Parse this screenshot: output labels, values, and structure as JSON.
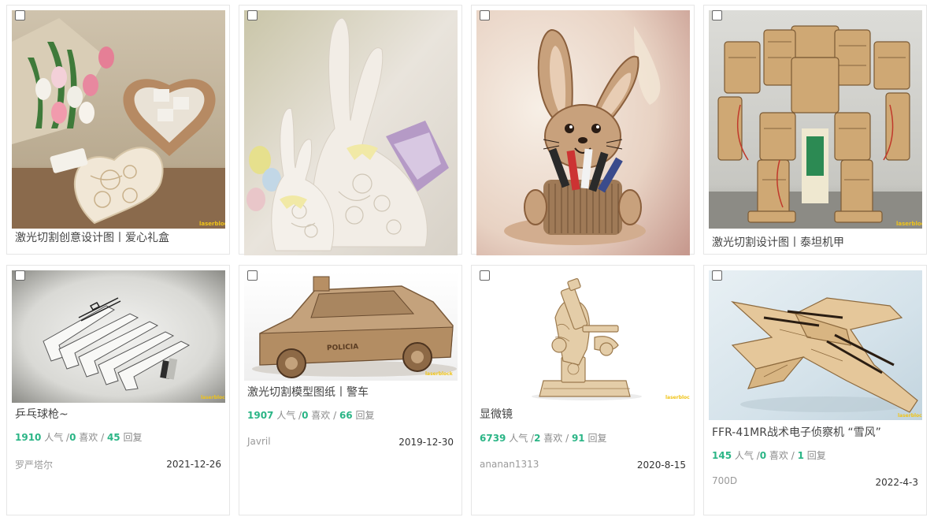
{
  "cards": [
    {
      "title": "激光切割创意设计图丨爱心礼盒",
      "image": "heart-gift-box",
      "watermark": "laserblock"
    },
    {
      "title": "",
      "image": "lace-rabbits",
      "watermark": ""
    },
    {
      "title": "",
      "image": "rabbit-pen-holder",
      "watermark": ""
    },
    {
      "title": "激光切割设计图丨泰坦机甲",
      "image": "titan-mech",
      "watermark": "laserblock"
    },
    {
      "title": "乒乓球枪~",
      "image": "ping-pong-gun",
      "views": "1910",
      "likes": "0",
      "replies": "45",
      "author": "罗严塔尔",
      "date": "2021-12-26",
      "watermark": "laserblock"
    },
    {
      "title": "激光切割模型图纸丨警车",
      "image": "police-car",
      "views": "1907",
      "likes": "0",
      "replies": "66",
      "author": "Javril",
      "date": "2019-12-30",
      "watermark": "laserblock",
      "car_text": "POLICIA"
    },
    {
      "title": "显微镜",
      "image": "microscope",
      "views": "6739",
      "likes": "2",
      "replies": "91",
      "author": "ananan1313",
      "date": "2020-8-15",
      "watermark": "laserblock"
    },
    {
      "title": "FFR-41MR战术电子侦察机 “雪风”",
      "image": "jet-plane",
      "views": "145",
      "likes": "0",
      "replies": "1",
      "author": "700D",
      "date": "2022-4-3",
      "watermark": "laserblock"
    }
  ],
  "labels": {
    "views": " 人气 /",
    "likes": " 喜欢 / ",
    "replies": " 回复"
  },
  "colors": {
    "stat_number": "#2bb586",
    "border": "#e6e6e6"
  }
}
